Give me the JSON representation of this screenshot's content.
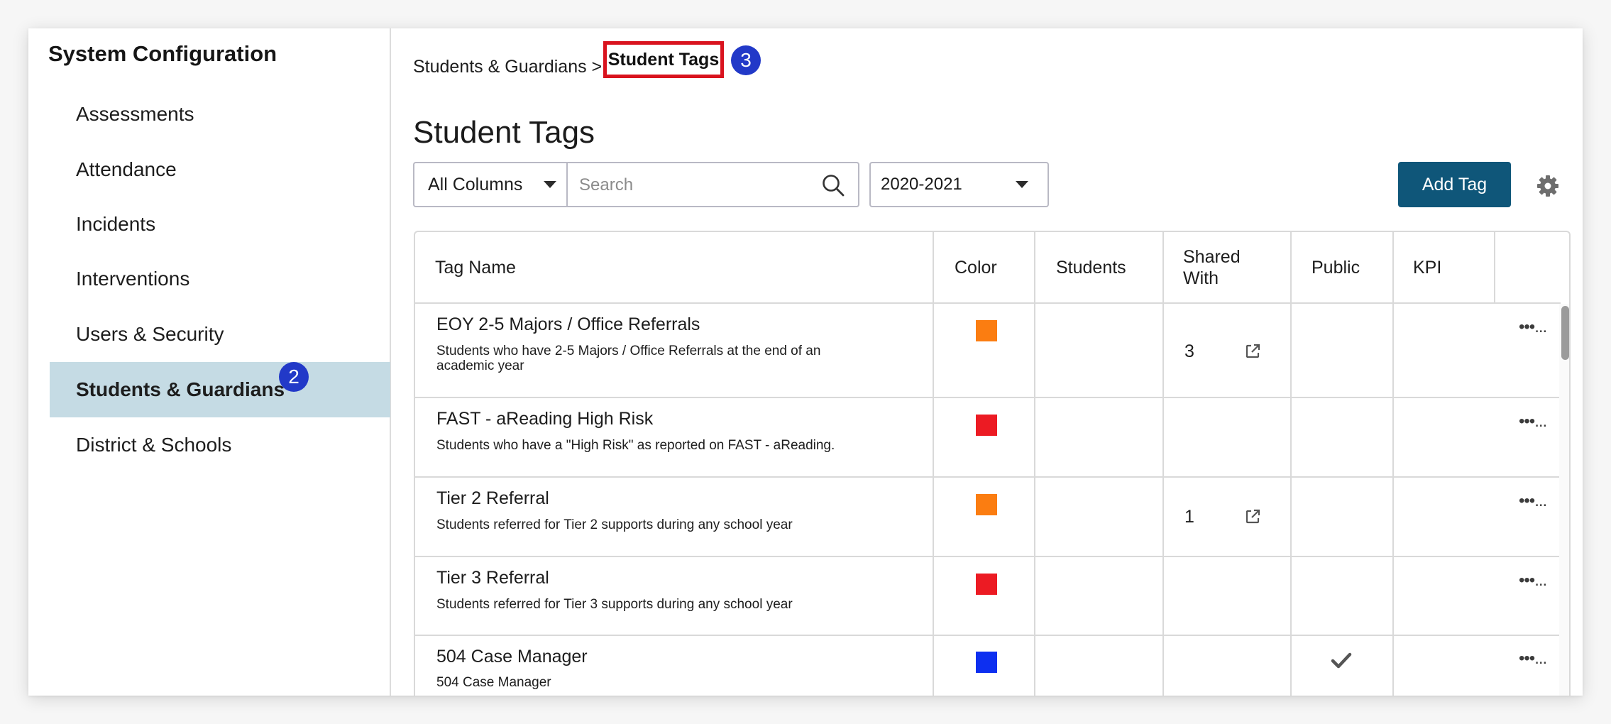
{
  "sidebar": {
    "title": "System Configuration",
    "items": [
      {
        "label": "Assessments"
      },
      {
        "label": "Attendance"
      },
      {
        "label": "Incidents"
      },
      {
        "label": "Interventions"
      },
      {
        "label": "Users & Security"
      },
      {
        "label": "Students & Guardians",
        "active": true,
        "badge": "2"
      },
      {
        "label": "District & Schools"
      }
    ]
  },
  "breadcrumb": {
    "parent": "Students & Guardians",
    "separator": ">",
    "current": "Student Tags",
    "badge": "3"
  },
  "page": {
    "title": "Student Tags"
  },
  "toolbar": {
    "column_filter": "All Columns",
    "search_placeholder": "Search",
    "school_year": "2020-2021",
    "add_button": "Add Tag",
    "settings_icon": "gear-icon"
  },
  "table": {
    "headers": {
      "tag_name": "Tag Name",
      "color": "Color",
      "students": "Students",
      "shared_with_line1": "Shared",
      "shared_with_line2": "With",
      "public": "Public",
      "kpi": "KPI"
    },
    "rows": [
      {
        "name": "EOY 2-5 Majors / Office Referrals",
        "description": "Students who have 2-5 Majors / Office Referrals at the end of an academic year",
        "color": "#fb7d11",
        "shared_with": "3",
        "public": false,
        "menu": "•••..."
      },
      {
        "name": "FAST - aReading High Risk",
        "description": "Students who have a \"High Risk\" as reported on FAST - aReading.",
        "color": "#ec1b23",
        "shared_with": "",
        "public": false,
        "menu": "•••..."
      },
      {
        "name": "Tier 2 Referral",
        "description": "Students referred for Tier 2 supports during any school year",
        "color": "#fb7d11",
        "shared_with": "1",
        "public": false,
        "menu": "•••..."
      },
      {
        "name": "Tier 3 Referral",
        "description": "Students referred for Tier 3 supports during any school year",
        "color": "#ec1b23",
        "shared_with": "",
        "public": false,
        "menu": "•••..."
      },
      {
        "name": "504 Case Manager",
        "description": "504 Case Manager",
        "color": "#0d2ff0",
        "shared_with": "",
        "public": true,
        "menu": "•••..."
      }
    ]
  },
  "colors": {
    "accent": "#0f5679",
    "active_nav": "#c5dbe4",
    "badge": "#2239c8",
    "highlight_box": "#d9131e"
  }
}
